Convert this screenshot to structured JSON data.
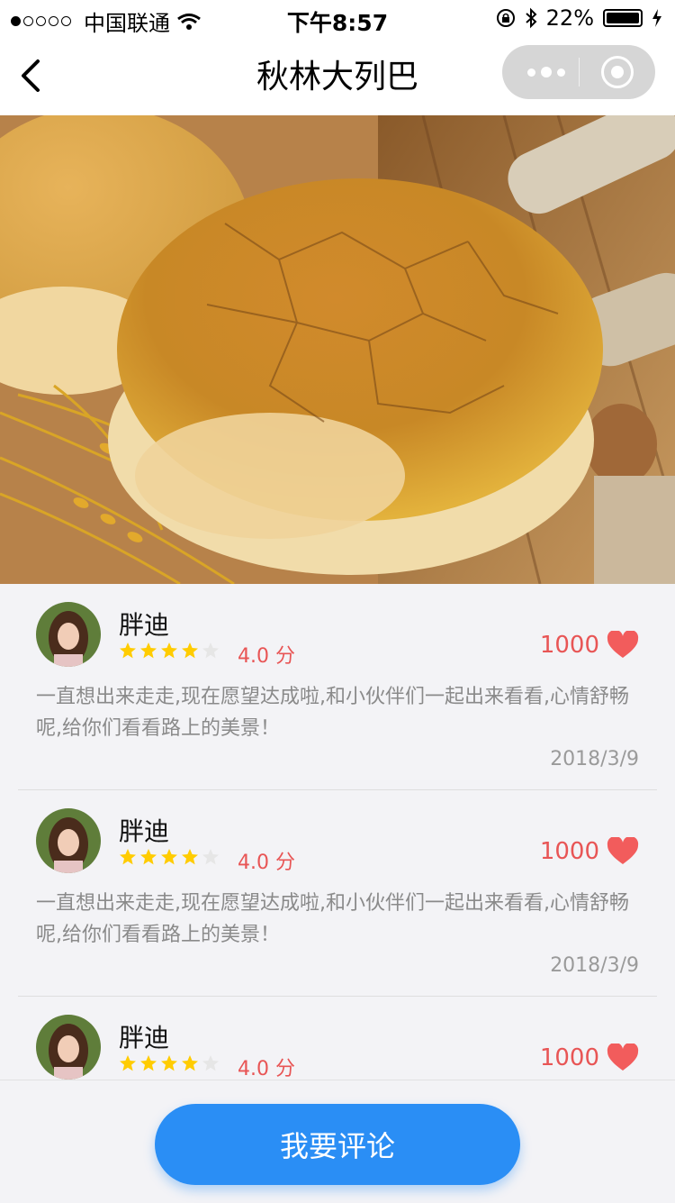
{
  "status_bar": {
    "carrier": "中国联通",
    "time": "下午8:57",
    "battery_percent": "22%"
  },
  "nav": {
    "title": "秋林大列巴"
  },
  "comments": [
    {
      "user": "胖迪",
      "score_text": "4.0 分",
      "rating": 4,
      "likes": "1000",
      "text": "一直想出来走走,现在愿望达成啦,和小伙伴们一起出来看看,心情舒畅呢,给你们看看路上的美景！",
      "date": "2018/3/9"
    },
    {
      "user": "胖迪",
      "score_text": "4.0 分",
      "rating": 4,
      "likes": "1000",
      "text": "一直想出来走走,现在愿望达成啦,和小伙伴们一起出来看看,心情舒畅呢,给你们看看路上的美景！",
      "date": "2018/3/9"
    },
    {
      "user": "胖迪",
      "score_text": "4.0 分",
      "rating": 4,
      "likes": "1000",
      "text": "",
      "date": ""
    }
  ],
  "footer": {
    "comment_button": "我要评论"
  },
  "colors": {
    "accent": "#2a8ef5",
    "heart": "#f25c5c",
    "star": "#ffcc00"
  }
}
